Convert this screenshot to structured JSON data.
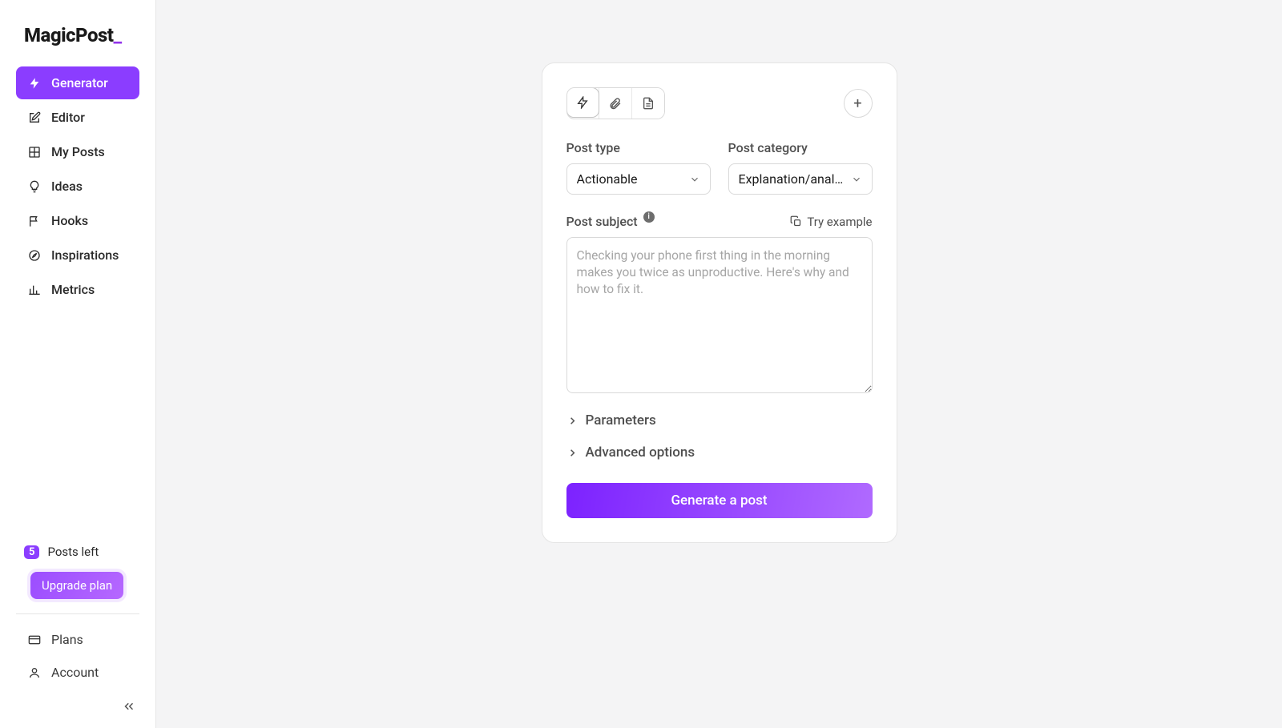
{
  "brand": {
    "name": "MagicPost",
    "cursor": "_"
  },
  "sidebar": {
    "items": [
      {
        "label": "Generator"
      },
      {
        "label": "Editor"
      },
      {
        "label": "My Posts"
      },
      {
        "label": "Ideas"
      },
      {
        "label": "Hooks"
      },
      {
        "label": "Inspirations"
      },
      {
        "label": "Metrics"
      }
    ],
    "posts_left_count": "5",
    "posts_left_label": "Posts left",
    "upgrade_label": "Upgrade plan",
    "plans_label": "Plans",
    "account_label": "Account"
  },
  "form": {
    "post_type_label": "Post type",
    "post_type_value": "Actionable",
    "post_category_label": "Post category",
    "post_category_value": "Explanation/analysis",
    "post_subject_label": "Post subject",
    "try_example_label": "Try example",
    "subject_placeholder": "Checking your phone first thing in the morning makes you twice as unproductive. Here's why and how to fix it.",
    "parameters_label": "Parameters",
    "advanced_label": "Advanced options",
    "generate_label": "Generate a post",
    "add_label": "+"
  }
}
